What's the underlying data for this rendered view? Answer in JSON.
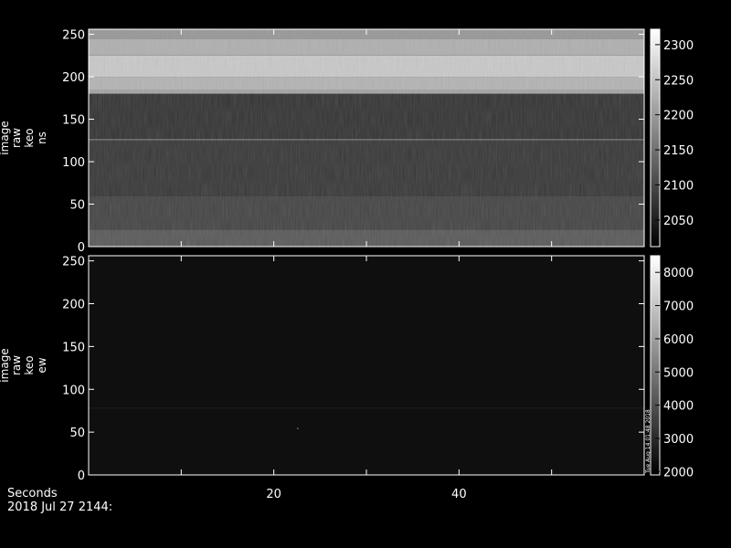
{
  "chart_data": [
    {
      "type": "heatmap",
      "title": "",
      "ylabel": [
        "image",
        "raw",
        "keo",
        "ns"
      ],
      "xlabel": "",
      "xlim": [
        0,
        60
      ],
      "ylim": [
        0,
        256
      ],
      "yticks": [
        0,
        50,
        100,
        150,
        200,
        250
      ],
      "colorbar": {
        "ticks": [
          2050,
          2100,
          2150,
          2200,
          2250,
          2300
        ],
        "range": [
          2012,
          2322
        ]
      },
      "bands": [
        {
          "y": [
            0,
            20
          ],
          "value": 2120
        },
        {
          "y": [
            20,
            60
          ],
          "value": 2095
        },
        {
          "y": [
            60,
            125
          ],
          "value": 2080
        },
        {
          "y": [
            125,
            127
          ],
          "value": 2140
        },
        {
          "y": [
            127,
            180
          ],
          "value": 2075
        },
        {
          "y": [
            180,
            185
          ],
          "value": 2210
        },
        {
          "y": [
            185,
            200
          ],
          "value": 2230
        },
        {
          "y": [
            200,
            225
          ],
          "value": 2255
        },
        {
          "y": [
            225,
            245
          ],
          "value": 2225
        },
        {
          "y": [
            245,
            256
          ],
          "value": 2195
        }
      ]
    },
    {
      "type": "heatmap",
      "title": "",
      "ylabel": [
        "image",
        "raw",
        "keo",
        "ew"
      ],
      "xlabel": "Seconds",
      "xlim": [
        0,
        60
      ],
      "ylim": [
        0,
        256
      ],
      "xticks": [
        20,
        40
      ],
      "yticks": [
        0,
        50,
        100,
        150,
        200,
        250
      ],
      "colorbar": {
        "ticks": [
          2000,
          3000,
          4000,
          5000,
          6000,
          7000,
          8000
        ],
        "range": [
          1900,
          8500
        ]
      },
      "background_value": 2300,
      "lines": [
        {
          "y": 78,
          "value": 2700
        }
      ],
      "points": [
        {
          "x": 22.5,
          "y": 55,
          "value": 5000
        }
      ]
    }
  ],
  "footer": {
    "xaxis_title": "Seconds",
    "date": "2018 Jul 27 2144:"
  },
  "colorbar_side_note": "Tue Aug 14 01:48 2018"
}
